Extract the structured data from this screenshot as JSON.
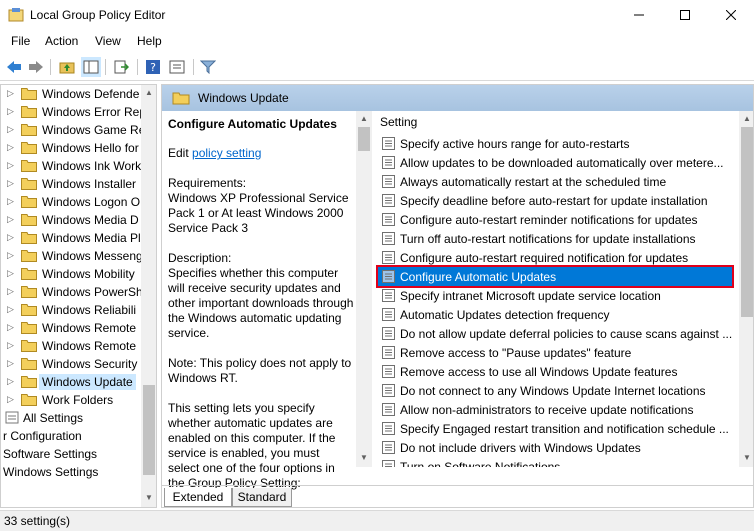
{
  "window": {
    "title": "Local Group Policy Editor"
  },
  "menu": [
    "File",
    "Action",
    "View",
    "Help"
  ],
  "tree": {
    "items": [
      {
        "label": "Windows Defende",
        "selected": false
      },
      {
        "label": "Windows Error Rep",
        "selected": false
      },
      {
        "label": "Windows Game Re",
        "selected": false
      },
      {
        "label": "Windows Hello for",
        "selected": false
      },
      {
        "label": "Windows Ink Work",
        "selected": false
      },
      {
        "label": "Windows Installer",
        "selected": false
      },
      {
        "label": "Windows Logon O",
        "selected": false
      },
      {
        "label": "Windows Media D",
        "selected": false
      },
      {
        "label": "Windows Media Pl",
        "selected": false
      },
      {
        "label": "Windows Messeng",
        "selected": false
      },
      {
        "label": "Windows Mobility",
        "selected": false
      },
      {
        "label": "Windows PowerSh",
        "selected": false
      },
      {
        "label": "Windows Reliabili",
        "selected": false
      },
      {
        "label": "Windows Remote",
        "selected": false
      },
      {
        "label": "Windows Remote",
        "selected": false
      },
      {
        "label": "Windows Security",
        "selected": false
      },
      {
        "label": "Windows Update",
        "selected": true
      },
      {
        "label": "Work Folders",
        "selected": false
      }
    ],
    "all_settings": "All Settings",
    "config": "r Configuration",
    "software_settings": "Software Settings",
    "windows_settings": "Windows Settings"
  },
  "panel": {
    "header": "Windows Update",
    "desc": {
      "title": "Configure Automatic Updates",
      "edit_prefix": "Edit",
      "edit_link": "policy setting",
      "requirements": "Requirements:\nWindows XP Professional Service Pack 1 or At least Windows 2000 Service Pack 3",
      "description": "Description:\nSpecifies whether this computer will receive security updates and other important downloads through the Windows automatic updating service.",
      "note": "Note: This policy does not apply to Windows RT.",
      "more": "This setting lets you specify whether automatic updates are enabled on this computer. If the service is enabled, you must select one of the four options in the Group Policy Setting:"
    },
    "column_header": "Setting",
    "settings": [
      "Specify active hours range for auto-restarts",
      "Allow updates to be downloaded automatically over metere...",
      "Always automatically restart at the scheduled time",
      "Specify deadline before auto-restart for update installation",
      "Configure auto-restart reminder notifications for updates",
      "Turn off auto-restart notifications for update installations",
      "Configure auto-restart required notification for updates",
      "Configure Automatic Updates",
      "Specify intranet Microsoft update service location",
      "Automatic Updates detection frequency",
      "Do not allow update deferral policies to cause scans against ...",
      "Remove access to \"Pause updates\" feature",
      "Remove access to use all Windows Update features",
      "Do not connect to any Windows Update Internet locations",
      "Allow non-administrators to receive update notifications",
      "Specify Engaged restart transition and notification schedule ...",
      "Do not include drivers with Windows Updates",
      "Turn on Software Notifications"
    ],
    "selected_index": 7,
    "tabs": [
      "Extended",
      "Standard"
    ]
  },
  "status": {
    "text": "33 setting(s)"
  }
}
